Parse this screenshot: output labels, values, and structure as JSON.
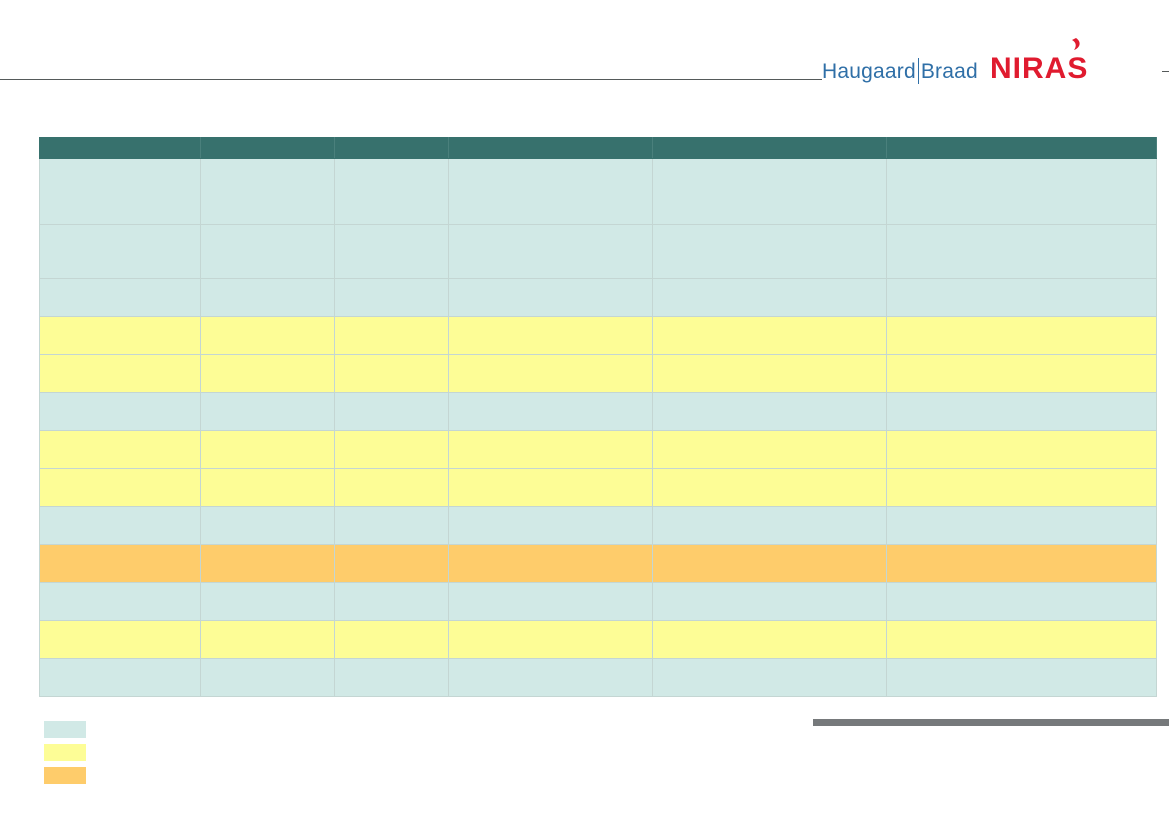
{
  "logo": {
    "left_text": "Haugaard",
    "right_text": "Braad",
    "brand": "NIRAS",
    "brand_color": "#e01b2f",
    "hb_color": "#2f6fa7"
  },
  "colors": {
    "header": "#37716d",
    "teal": "#d1e9e6",
    "yellow": "#fdfd96",
    "orange": "#fecc6b"
  },
  "table": {
    "headers": [
      "",
      "",
      "",
      "",
      "",
      ""
    ],
    "row_colors": [
      "teal",
      "teal",
      "teal",
      "yellow",
      "yellow",
      "teal",
      "yellow",
      "yellow",
      "teal",
      "orange",
      "teal",
      "yellow",
      "teal"
    ]
  },
  "legend": {
    "items": [
      {
        "color": "teal",
        "label": ""
      },
      {
        "color": "yellow",
        "label": ""
      },
      {
        "color": "orange",
        "label": ""
      }
    ]
  }
}
